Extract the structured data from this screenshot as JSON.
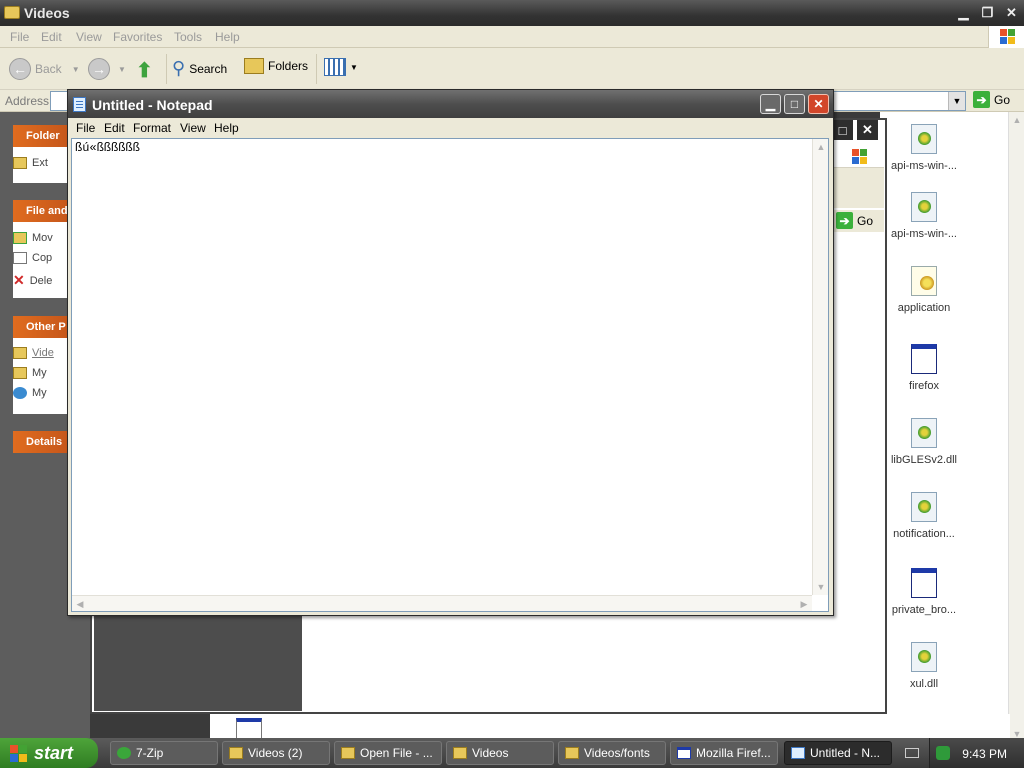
{
  "explorer": {
    "title": "Videos",
    "menu": [
      "File",
      "Edit",
      "View",
      "Favorites",
      "Tools",
      "Help"
    ],
    "toolbar": {
      "back_label": "Back",
      "search_label": "Search",
      "folders_label": "Folders"
    },
    "address_label": "Address",
    "go_label": "Go",
    "task_panes": {
      "folder_tasks_head": "Folder",
      "folder_task_item": "Ext",
      "file_tasks_head": "File and",
      "file_task_items": [
        "Mov",
        "Cop",
        "Dele"
      ],
      "other_places_head": "Other P",
      "other_place_items": [
        "Vide",
        "My",
        "My"
      ],
      "details_head": "Details"
    },
    "files": [
      {
        "label": "api-ms-win-...",
        "icon": "dll-icon"
      },
      {
        "label": "api-ms-win-...",
        "icon": "dll-icon"
      },
      {
        "label": "application",
        "icon": "config-icon"
      },
      {
        "label": "firefox",
        "icon": "app-window-icon"
      },
      {
        "label": "libGLESv2.dll",
        "icon": "dll-icon"
      },
      {
        "label": "notification...",
        "icon": "dll-icon"
      },
      {
        "label": "private_bro...",
        "icon": "app-window-icon"
      },
      {
        "label": "xul.dll",
        "icon": "dll-icon"
      }
    ]
  },
  "second_window": {
    "go_label": "Go"
  },
  "notepad": {
    "title": "Untitled - Notepad",
    "menu": [
      "File",
      "Edit",
      "Format",
      "View",
      "Help"
    ],
    "content": "ßú«ßßßßßß"
  },
  "taskbar": {
    "start_label": "start",
    "tasks": [
      {
        "label": "7-Zip",
        "active": false
      },
      {
        "label": "Videos (2)",
        "active": false
      },
      {
        "label": "Open File - ...",
        "active": false
      },
      {
        "label": "Videos",
        "active": false
      },
      {
        "label": "Videos/fonts",
        "active": false
      },
      {
        "label": "Mozilla Firef...",
        "active": false
      },
      {
        "label": "Untitled - N...",
        "active": true
      }
    ],
    "clock": "9:43 PM"
  },
  "colors": {
    "start_green": "#3f9a32",
    "task_orange": "#d9651e",
    "close_red": "#d2462a"
  }
}
